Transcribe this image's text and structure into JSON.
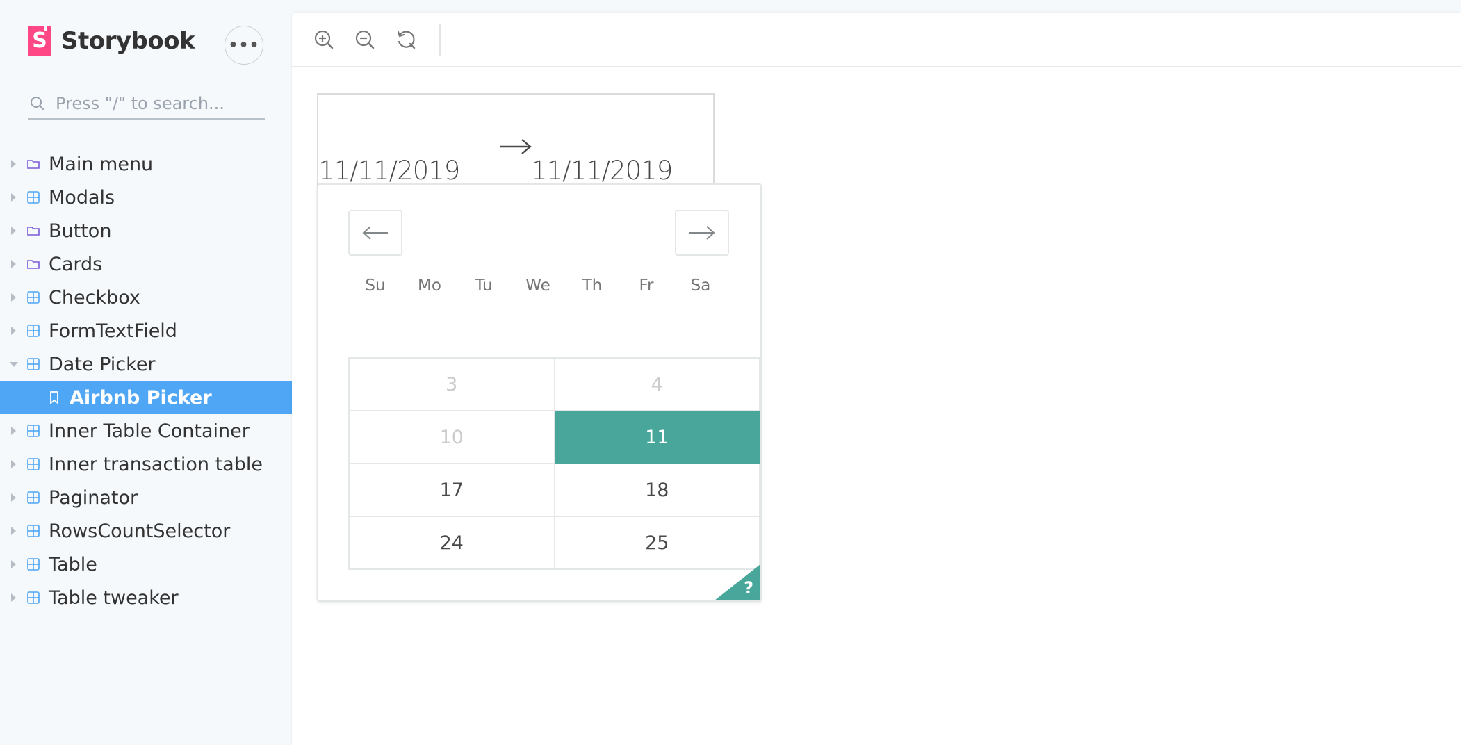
{
  "brand": {
    "name": "Storybook",
    "logo_letter": "S",
    "logo_color": "#ff4785"
  },
  "menu_button": {
    "icon": "ellipsis-icon",
    "label": "•••"
  },
  "search": {
    "placeholder": "Press \"/\" to search..."
  },
  "nav": {
    "items": [
      {
        "label": "Main menu",
        "icon": "folder-icon",
        "type": "folder"
      },
      {
        "label": "Modals",
        "icon": "component-icon",
        "type": "component"
      },
      {
        "label": "Button",
        "icon": "folder-icon",
        "type": "folder"
      },
      {
        "label": "Cards",
        "icon": "folder-icon",
        "type": "folder"
      },
      {
        "label": "Checkbox",
        "icon": "component-icon",
        "type": "component"
      },
      {
        "label": "FormTextField",
        "icon": "component-icon",
        "type": "component"
      },
      {
        "label": "Date Picker",
        "icon": "component-icon",
        "type": "component",
        "expanded": true
      },
      {
        "label": "Airbnb Picker",
        "icon": "bookmark-icon",
        "type": "story",
        "active": true
      },
      {
        "label": "Inner Table Container",
        "icon": "component-icon",
        "type": "component"
      },
      {
        "label": "Inner transaction table",
        "icon": "component-icon",
        "type": "component"
      },
      {
        "label": "Paginator",
        "icon": "component-icon",
        "type": "component"
      },
      {
        "label": "RowsCountSelector",
        "icon": "component-icon",
        "type": "component"
      },
      {
        "label": "Table",
        "icon": "component-icon",
        "type": "component"
      },
      {
        "label": "Table tweaker",
        "icon": "component-icon",
        "type": "component"
      }
    ],
    "active_color": "#4ea6f4"
  },
  "toolbar": {
    "buttons": [
      {
        "name": "zoom-in",
        "icon": "zoom-in-icon"
      },
      {
        "name": "zoom-out",
        "icon": "zoom-out-icon"
      },
      {
        "name": "reset-zoom",
        "icon": "reset-icon"
      }
    ]
  },
  "date_range": {
    "start_date": "11/11/2019",
    "end_date": "11/11/2019",
    "arrow_icon": "arrow-right-icon"
  },
  "calendar": {
    "prev_icon": "arrow-left-icon",
    "next_icon": "arrow-right-icon",
    "weekdays": [
      "Su",
      "Mo",
      "Tu",
      "We",
      "Th",
      "Fr",
      "Sa"
    ],
    "rows": [
      [
        {
          "day": "3",
          "state": "muted"
        },
        {
          "day": "4",
          "state": "muted"
        }
      ],
      [
        {
          "day": "10",
          "state": "muted"
        },
        {
          "day": "11",
          "state": "selected"
        }
      ],
      [
        {
          "day": "17",
          "state": "normal"
        },
        {
          "day": "18",
          "state": "normal"
        }
      ],
      [
        {
          "day": "24",
          "state": "normal"
        },
        {
          "day": "25",
          "state": "normal"
        }
      ]
    ],
    "selected_color": "#48a69a",
    "help_label": "?"
  }
}
